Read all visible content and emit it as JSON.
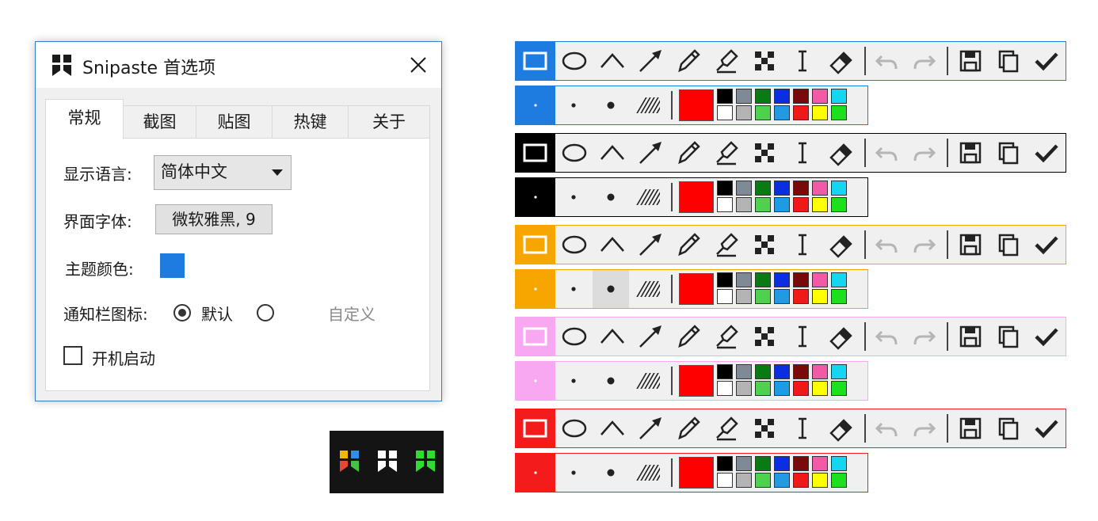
{
  "dialog": {
    "title": "Snipaste 首选项",
    "accent": "#2b80d6",
    "tabs": [
      {
        "label": "常规"
      },
      {
        "label": "截图"
      },
      {
        "label": "贴图"
      },
      {
        "label": "热键"
      },
      {
        "label": "关于"
      }
    ],
    "active_tab": 0,
    "general": {
      "language_label": "显示语言:",
      "language_value": "简体中文",
      "font_label": "界面字体:",
      "font_value": "微软雅黑, 9",
      "theme_label": "主题颜色:",
      "theme_color": "#1e7be0",
      "tray_icon_label": "通知栏图标:",
      "tray_default_label": "默认",
      "tray_custom_label": "自定义",
      "tray_selected": "default",
      "startup_label": "开机启动",
      "startup_checked": false
    }
  },
  "tray_icons": [
    {
      "name": "colorful-logo-icon",
      "colors": [
        "#e8463b",
        "#f5b60a",
        "#2f8fe6",
        "#45c245"
      ]
    },
    {
      "name": "white-logo-icon",
      "colors": [
        "#ffffff",
        "#ffffff",
        "#ffffff",
        "#ffffff"
      ]
    },
    {
      "name": "green-logo-icon",
      "colors": [
        "#2fdc2f",
        "#2fdc2f",
        "#2fdc2f",
        "#2fdc2f"
      ]
    }
  ],
  "toolbar_themes": [
    {
      "name": "blue",
      "accent": "#1e7be0",
      "border": "#1e7be0",
      "inner": "#ffffff",
      "selected_size": null
    },
    {
      "name": "black",
      "accent": "#000000",
      "border": "#000000",
      "inner": "#ffffff",
      "selected_size": null
    },
    {
      "name": "orange",
      "accent": "#f7a600",
      "border": "#f7a600",
      "inner": "#ffffff",
      "selected_size": 1
    },
    {
      "name": "pink",
      "accent": "#f7a8f0",
      "border": "#f7a8f0",
      "inner": "#ffffff",
      "selected_size": null
    },
    {
      "name": "red",
      "accent": "#f31b1b",
      "border": "#f31b1b",
      "inner": "#ffffff",
      "selected_size": null
    }
  ],
  "tools": [
    {
      "name": "rectangle-tool-icon"
    },
    {
      "name": "ellipse-tool-icon"
    },
    {
      "name": "polyline-tool-icon"
    },
    {
      "name": "arrow-tool-icon"
    },
    {
      "name": "pencil-tool-icon"
    },
    {
      "name": "marker-tool-icon"
    },
    {
      "name": "mosaic-tool-icon"
    },
    {
      "name": "text-tool-icon"
    },
    {
      "name": "eraser-tool-icon"
    },
    {
      "name": "undo-icon"
    },
    {
      "name": "redo-icon"
    },
    {
      "name": "save-icon"
    },
    {
      "name": "copy-icon"
    },
    {
      "name": "confirm-check-icon"
    }
  ],
  "current_color": "#ff0000",
  "palette": {
    "top": [
      "#000000",
      "#7f8a96",
      "#0a7a12",
      "#0a2ee0",
      "#7a0a0a",
      "#f05aa6",
      "#14d6f0"
    ],
    "bottom": [
      "#ffffff",
      "#b4b4b4",
      "#4fd04f",
      "#1f9be6",
      "#f21818",
      "#ffff00",
      "#1ce01c"
    ]
  }
}
